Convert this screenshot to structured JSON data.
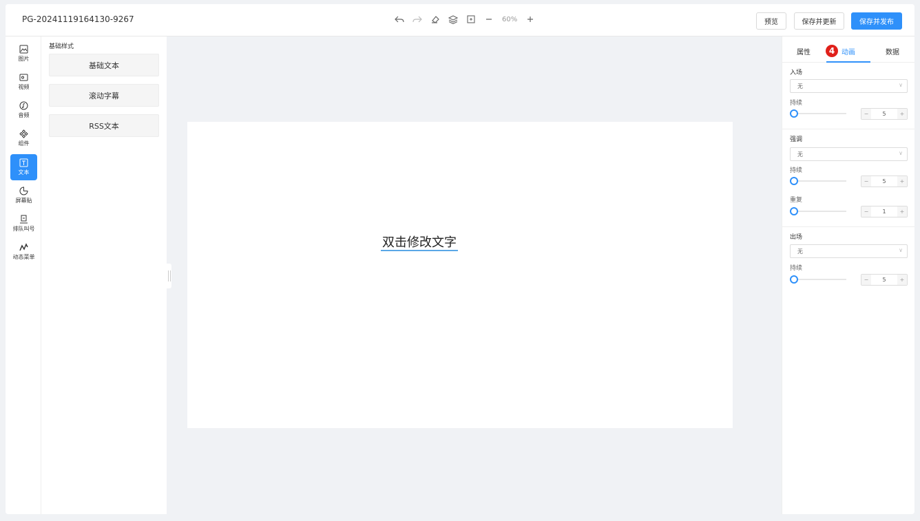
{
  "header": {
    "page_id": "PG-20241119164130-9267",
    "zoom": "60%",
    "buttons": {
      "preview": "预览",
      "save_update": "保存并更新",
      "save_publish": "保存并发布"
    }
  },
  "sidebar": {
    "items": [
      {
        "label": "图片",
        "icon": "image-icon"
      },
      {
        "label": "视频",
        "icon": "video-icon"
      },
      {
        "label": "音频",
        "icon": "audio-icon"
      },
      {
        "label": "组件",
        "icon": "component-icon"
      },
      {
        "label": "文本",
        "icon": "text-icon",
        "active": true
      },
      {
        "label": "屏幕贴",
        "icon": "sticker-icon"
      },
      {
        "label": "排队叫号",
        "icon": "queue-icon"
      },
      {
        "label": "动态菜单",
        "icon": "dynamic-menu-icon"
      }
    ]
  },
  "library": {
    "title": "基础样式",
    "cards": [
      "基础文本",
      "滚动字幕",
      "RSS文本"
    ]
  },
  "canvas": {
    "text_element": "双击修改文字"
  },
  "panel": {
    "tabs": [
      "属性",
      "动画",
      "数据"
    ],
    "active_tab": "动画",
    "badge": "4",
    "entrance": {
      "title": "入场",
      "select": "无",
      "duration_label": "持续",
      "duration": "5"
    },
    "emphasis": {
      "title": "强调",
      "select": "无",
      "duration_label": "持续",
      "duration": "5",
      "repeat_label": "重复",
      "repeat": "1"
    },
    "exit": {
      "title": "出场",
      "select": "无",
      "duration_label": "持续",
      "duration": "5"
    },
    "stepper": {
      "minus": "−",
      "plus": "+"
    }
  },
  "colors": {
    "accent": "#2e90fa",
    "badge": "#e0201a",
    "canvas_bg": "#f0f2f5"
  }
}
